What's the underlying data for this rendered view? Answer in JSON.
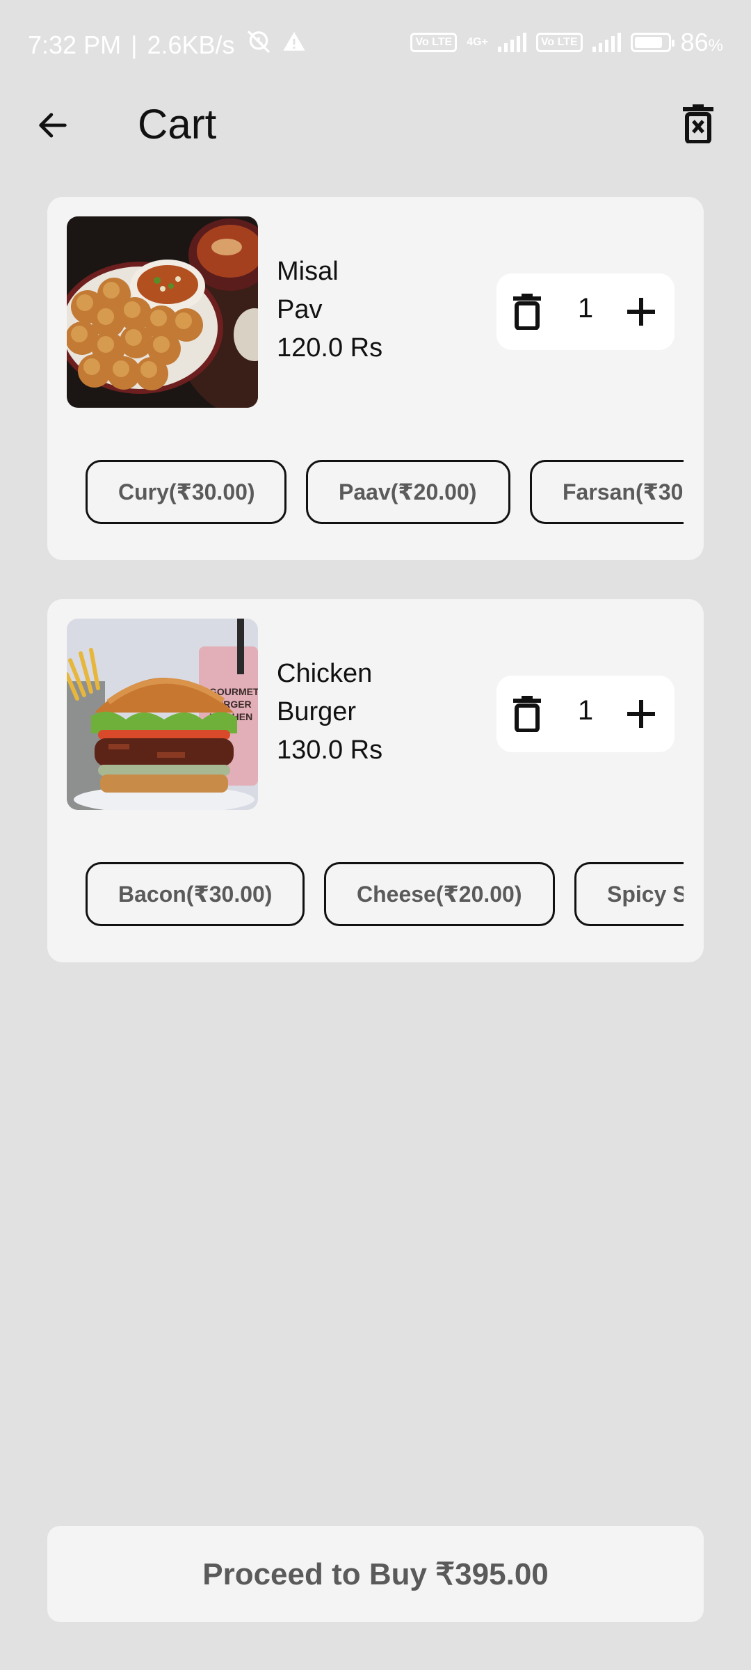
{
  "status_bar": {
    "time": "7:32 PM",
    "separator": "|",
    "net_speed": "2.6KB/s",
    "volte_1": "Vo LTE",
    "network_type": "4G+",
    "volte_2": "Vo LTE",
    "battery": "86",
    "battery_unit": "%"
  },
  "app_bar": {
    "title": "Cart"
  },
  "cart_items": [
    {
      "name_line1": "Misal",
      "name_line2": "Pav",
      "price": "120.0 Rs",
      "quantity": "1",
      "addons": [
        "Cury(₹30.00)",
        "Paav(₹20.00)",
        "Farsan(₹30."
      ]
    },
    {
      "name_line1": "Chicken",
      "name_line2": "Burger",
      "price": "130.0 Rs",
      "quantity": "1",
      "addons": [
        "Bacon(₹30.00)",
        "Cheese(₹20.00)",
        "Spicy S"
      ]
    }
  ],
  "proceed_button": {
    "label": "Proceed to Buy ₹395.00"
  },
  "icons": {
    "back": "arrow-left-icon",
    "clear_cart": "trash-x-icon",
    "remove_item": "trash-icon",
    "increment": "plus-icon"
  },
  "colors": {
    "background": "#e1e1e1",
    "card": "#f4f4f4",
    "chip_text": "#5a5a5a",
    "text": "#111111"
  }
}
